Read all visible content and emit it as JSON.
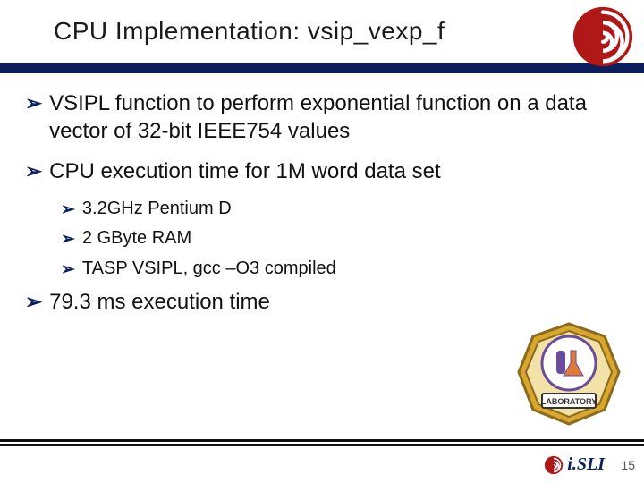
{
  "header": {
    "title": "CPU Implementation: vsip_vexp_f"
  },
  "bullets": {
    "b1": "VSIPL function to perform exponential function on a data vector of 32-bit IEEE754 values",
    "b2": "CPU execution time for 1M word data set",
    "b2_1": "3.2GHz Pentium D",
    "b2_2": "2 GByte RAM",
    "b2_3": "TASP VSIPL, gcc –O3 compiled",
    "b3": "79.3 ms execution time"
  },
  "footer": {
    "brand": "i.SLI",
    "page": "15"
  },
  "icons": {
    "header_swirl": "swirl-logo",
    "lab_badge": "laboratory-badge",
    "footer_swirl": "swirl-logo-small"
  },
  "lab_label": "LABORATORY"
}
